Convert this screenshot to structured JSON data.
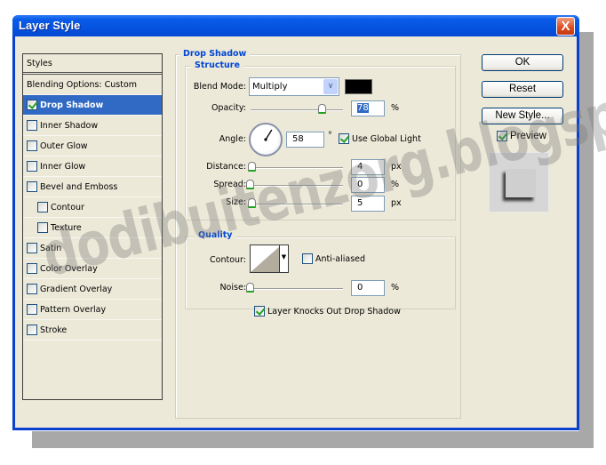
{
  "window": {
    "title": "Layer Style",
    "close_label": "X"
  },
  "styles": {
    "header": "Styles",
    "blending_options": "Blending Options: Custom",
    "items": [
      {
        "label": "Drop Shadow",
        "checked": true,
        "selected": true,
        "indent": false
      },
      {
        "label": "Inner Shadow",
        "checked": false,
        "selected": false,
        "indent": false
      },
      {
        "label": "Outer Glow",
        "checked": false,
        "selected": false,
        "indent": false
      },
      {
        "label": "Inner Glow",
        "checked": false,
        "selected": false,
        "indent": false
      },
      {
        "label": "Bevel and Emboss",
        "checked": false,
        "selected": false,
        "indent": false
      },
      {
        "label": "Contour",
        "checked": false,
        "selected": false,
        "indent": true
      },
      {
        "label": "Texture",
        "checked": false,
        "selected": false,
        "indent": true
      },
      {
        "label": "Satin",
        "checked": false,
        "selected": false,
        "indent": false
      },
      {
        "label": "Color Overlay",
        "checked": false,
        "selected": false,
        "indent": false
      },
      {
        "label": "Gradient Overlay",
        "checked": false,
        "selected": false,
        "indent": false
      },
      {
        "label": "Pattern Overlay",
        "checked": false,
        "selected": false,
        "indent": false
      },
      {
        "label": "Stroke",
        "checked": false,
        "selected": false,
        "indent": false
      }
    ]
  },
  "drop_shadow": {
    "title": "Drop Shadow",
    "structure": {
      "title": "Structure",
      "blend_mode": {
        "label": "Blend Mode:",
        "value": "Multiply",
        "color": "#000000"
      },
      "opacity": {
        "label": "Opacity:",
        "value": "78",
        "unit": "%",
        "slider_fraction": 0.78
      },
      "angle": {
        "label": "Angle:",
        "value": "58",
        "unit": "°",
        "degrees": 58
      },
      "use_global_light": {
        "label": "Use Global Light",
        "checked": true
      },
      "distance": {
        "label": "Distance:",
        "value": "4",
        "unit": "px",
        "slider_fraction": 0.02
      },
      "spread": {
        "label": "Spread:",
        "value": "0",
        "unit": "%",
        "slider_fraction": 0.0
      },
      "size": {
        "label": "Size:",
        "value": "5",
        "unit": "px",
        "slider_fraction": 0.02
      }
    },
    "quality": {
      "title": "Quality",
      "contour": {
        "label": "Contour:"
      },
      "anti_aliased": {
        "label": "Anti-aliased",
        "checked": false
      },
      "noise": {
        "label": "Noise:",
        "value": "0",
        "unit": "%",
        "slider_fraction": 0.0
      }
    },
    "knockout": {
      "label": "Layer Knocks Out Drop Shadow",
      "checked": true
    }
  },
  "buttons": {
    "ok": "OK",
    "reset": "Reset",
    "new_style": "New Style...",
    "preview": {
      "label": "Preview",
      "checked": true
    }
  },
  "watermark": "dodibuitenzorg.blogspot.com"
}
